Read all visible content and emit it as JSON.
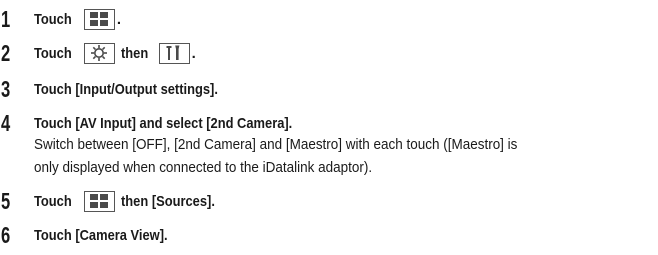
{
  "steps": [
    {
      "number": "1",
      "text_before": "Touch",
      "icon": "menu-grid-icon",
      "text_after": "."
    },
    {
      "number": "2",
      "text_before": "Touch",
      "icon": "settings-gear-icon",
      "middle": "then",
      "icon2": "tools-icon",
      "text_after": "."
    },
    {
      "number": "3",
      "text": "Touch [Input/Output settings]."
    },
    {
      "number": "4",
      "text": "Touch [AV Input] and select [2nd Camera].",
      "desc_line1": "Switch between [OFF], [2nd Camera] and [Maestro] with each touch ([Maestro] is",
      "desc_line2": "only displayed when connected to the iDatalink adaptor)."
    },
    {
      "number": "5",
      "text_before": "Touch",
      "icon": "menu-grid-icon",
      "text_after": "then [Sources]."
    },
    {
      "number": "6",
      "text": "Touch [Camera View]."
    }
  ],
  "colors": {
    "text": "#1a1a1a",
    "icon_fill": "#4a4a4a",
    "icon_border": "#555555"
  }
}
